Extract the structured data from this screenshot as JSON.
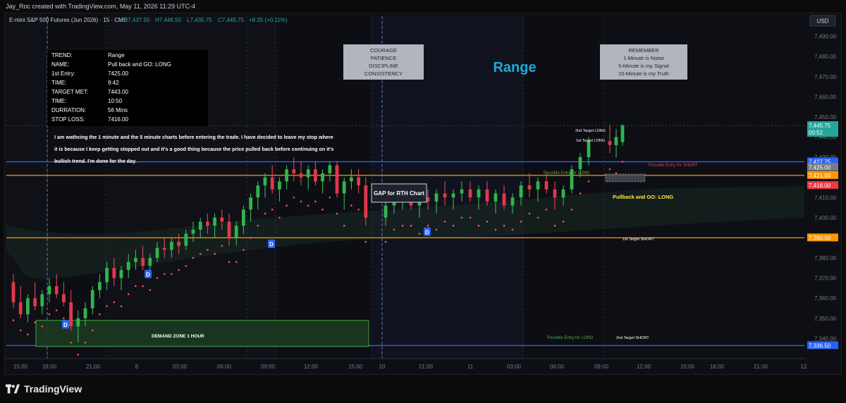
{
  "header": {
    "attribution": "Jay_Roc created with TradingView.com, May 11, 2026 11:29 UTC-4"
  },
  "symbol_info": {
    "name": "E-mini S&P 500 Futures (Jun 2026) · 15 · CME",
    "open": "O7,437.50",
    "high": "H7,446.50",
    "low": "L7,435.75",
    "close": "C7,445.75",
    "change": "+8.25 (+0.11%)",
    "currency": "USD"
  },
  "trade_box": {
    "rows": [
      {
        "key": "TREND:",
        "value": "Range"
      },
      {
        "key": "NAME:",
        "value": "Pull back and GO: LONG"
      },
      {
        "key": "1st Entry:",
        "value": "7425.00"
      },
      {
        "key": "TIME:",
        "value": "9:42"
      },
      {
        "key": "TARGET MET:",
        "value": "7443.00"
      },
      {
        "key": "TIME:",
        "value": "10:50"
      },
      {
        "key": "DURRATION:",
        "value": "56  Mins"
      },
      {
        "key": "STOP LOSS:",
        "value": "7416.00"
      }
    ]
  },
  "notes": {
    "commentary": [
      "I am wathcing the 1 minute and the 5 minute charts before entering the trade.  I have decided to leave my stop where",
      "it is because I keep getting stopped out and it's a good thing because the price pulled back before continuing on it's",
      "bullish trend.  I'm done for the day."
    ],
    "courage_box": [
      "COURAGE",
      "PATIENCE",
      "DISCIPLINE",
      "CONSISTENCY"
    ],
    "remember_box": [
      "REMEMBER",
      "1-Minute is Noise",
      "5-Minute is my Signal",
      "15-Minute is my Truth"
    ],
    "range_title": "Range",
    "gap_label": "GAP for RTH Chart",
    "demand_zone": "DEMAND ZONE 1 HOUR",
    "second_target_long": "2nd Target LONG",
    "first_target_long": "1st  Target LONG",
    "possible_entry_short": "Possible Entry for SHORT",
    "possible_entry_long_top": "Possible Entry for LONG",
    "pullback_label": "Pullback and GO: LONG",
    "first_target_short": "1st Target SHORT",
    "possible_entry_long_bottom": "Possible Entry for LONG",
    "second_target_short": "2nd Target SHORT",
    "marker": "D"
  },
  "chart_data": {
    "type": "candlestick",
    "timeframe": "15",
    "ylim": [
      7330,
      7500
    ],
    "y_ticks": [
      7340,
      7350,
      7360,
      7370,
      7380,
      7390,
      7400,
      7410,
      7420,
      7430,
      7440,
      7450,
      7460,
      7470,
      7480,
      7490
    ],
    "y_tick_labels": [
      "7,340.00",
      "7,350.00",
      "7,360.00",
      "7,370.00",
      "7,380.00",
      "7,390.00",
      "7,400.00",
      "7,410.00",
      "7,420.00",
      "7,430.00",
      "7,440.00",
      "7,450.00",
      "7,460.00",
      "7,470.00",
      "7,480.00",
      "7,490.00"
    ],
    "x_tick_labels": [
      "15:00",
      "18:00",
      "21:00",
      "8",
      "03:00",
      "06:00",
      "09:00",
      "12:00",
      "15:00",
      "10",
      "21:00",
      "11",
      "03:00",
      "06:00",
      "09:00",
      "12:00",
      "15:00",
      "18:00",
      "21:00",
      "12"
    ],
    "price_labels": [
      {
        "value": 7445.75,
        "text": "7,445.75",
        "sub": "00:52",
        "color": "#26a69a"
      },
      {
        "value": 7427.75,
        "text": "7,427.75",
        "color": "#2962ff"
      },
      {
        "value": 7425.0,
        "text": "7,425.00",
        "color": "#787b86"
      },
      {
        "value": 7421.0,
        "text": "7,421.00",
        "color": "#ff9800"
      },
      {
        "value": 7416.0,
        "text": "7,416.00",
        "color": "#f23645"
      },
      {
        "value": 7390.0,
        "text": "7,390.00",
        "color": "#ff9800"
      },
      {
        "value": 7336.5,
        "text": "7,336.50",
        "color": "#2962ff"
      }
    ],
    "horizontal_lines": [
      {
        "value": 7427.75,
        "color": "#2962ff"
      },
      {
        "value": 7421.0,
        "color": "#ff9800"
      },
      {
        "value": 7390.0,
        "color": "#ff9800"
      },
      {
        "value": 7336.5,
        "color": "#2962ff"
      }
    ],
    "candles": [
      [
        7368,
        7372,
        7355,
        7358
      ],
      [
        7358,
        7366,
        7350,
        7352
      ],
      [
        7352,
        7362,
        7348,
        7360
      ],
      [
        7360,
        7368,
        7354,
        7356
      ],
      [
        7356,
        7364,
        7352,
        7362
      ],
      [
        7362,
        7370,
        7358,
        7366
      ],
      [
        7366,
        7372,
        7360,
        7362
      ],
      [
        7362,
        7368,
        7356,
        7358
      ],
      [
        7358,
        7364,
        7344,
        7346
      ],
      [
        7346,
        7354,
        7338,
        7350
      ],
      [
        7350,
        7358,
        7346,
        7355
      ],
      [
        7355,
        7366,
        7352,
        7364
      ],
      [
        7364,
        7372,
        7360,
        7368
      ],
      [
        7368,
        7378,
        7364,
        7375
      ],
      [
        7375,
        7380,
        7366,
        7370
      ],
      [
        7370,
        7376,
        7364,
        7374
      ],
      [
        7374,
        7382,
        7370,
        7378
      ],
      [
        7378,
        7384,
        7374,
        7380
      ],
      [
        7380,
        7386,
        7374,
        7376
      ],
      [
        7376,
        7382,
        7372,
        7380
      ],
      [
        7380,
        7388,
        7378,
        7385
      ],
      [
        7385,
        7390,
        7380,
        7384
      ],
      [
        7384,
        7390,
        7380,
        7388
      ],
      [
        7388,
        7392,
        7382,
        7386
      ],
      [
        7386,
        7394,
        7384,
        7392
      ],
      [
        7392,
        7398,
        7388,
        7394
      ],
      [
        7394,
        7400,
        7390,
        7398
      ],
      [
        7398,
        7402,
        7392,
        7396
      ],
      [
        7396,
        7402,
        7390,
        7400
      ],
      [
        7400,
        7404,
        7394,
        7398
      ],
      [
        7398,
        7402,
        7386,
        7390
      ],
      [
        7390,
        7398,
        7386,
        7396
      ],
      [
        7396,
        7406,
        7392,
        7404
      ],
      [
        7404,
        7412,
        7398,
        7410
      ],
      [
        7410,
        7418,
        7404,
        7416
      ],
      [
        7416,
        7422,
        7410,
        7420
      ],
      [
        7420,
        7426,
        7412,
        7414
      ],
      [
        7414,
        7420,
        7408,
        7418
      ],
      [
        7418,
        7426,
        7414,
        7424
      ],
      [
        7424,
        7430,
        7418,
        7422
      ],
      [
        7422,
        7428,
        7416,
        7420
      ],
      [
        7420,
        7426,
        7414,
        7424
      ],
      [
        7424,
        7428,
        7416,
        7418
      ],
      [
        7418,
        7424,
        7412,
        7422
      ],
      [
        7422,
        7428,
        7418,
        7426
      ],
      [
        7426,
        7428,
        7410,
        7412
      ],
      [
        7412,
        7420,
        7404,
        7418
      ],
      [
        7418,
        7424,
        7414,
        7420
      ],
      [
        7420,
        7424,
        7412,
        7416
      ],
      [
        7416,
        7420,
        7396,
        7400
      ],
      [
        7400,
        7410,
        7396,
        7406
      ],
      [
        7406,
        7412,
        7402,
        7408
      ],
      [
        7408,
        7414,
        7404,
        7410
      ],
      [
        7410,
        7416,
        7404,
        7406
      ],
      [
        7406,
        7412,
        7400,
        7410
      ],
      [
        7410,
        7414,
        7404,
        7408
      ],
      [
        7408,
        7414,
        7402,
        7412
      ],
      [
        7412,
        7418,
        7406,
        7410
      ],
      [
        7410,
        7414,
        7404,
        7412
      ],
      [
        7412,
        7418,
        7408,
        7414
      ],
      [
        7414,
        7418,
        7408,
        7410
      ],
      [
        7410,
        7416,
        7404,
        7414
      ],
      [
        7414,
        7418,
        7406,
        7408
      ],
      [
        7408,
        7414,
        7402,
        7412
      ],
      [
        7412,
        7416,
        7404,
        7406
      ],
      [
        7406,
        7412,
        7402,
        7410
      ],
      [
        7410,
        7418,
        7406,
        7416
      ],
      [
        7416,
        7422,
        7410,
        7414
      ],
      [
        7414,
        7420,
        7408,
        7418
      ],
      [
        7418,
        7422,
        7412,
        7414
      ],
      [
        7414,
        7418,
        7404,
        7410
      ],
      [
        7410,
        7416,
        7406,
        7414
      ],
      [
        7414,
        7426,
        7412,
        7424
      ],
      [
        7424,
        7432,
        7420,
        7430
      ],
      [
        7430,
        7440,
        7426,
        7438
      ],
      [
        7438,
        7446,
        7432,
        7436
      ],
      [
        7436,
        7444,
        7430,
        7440
      ],
      [
        7437.5,
        7446.5,
        7435.75,
        7445.75
      ]
    ],
    "candle_x_positions_note": "candles are spaced across the visible sessions left to right"
  }
}
